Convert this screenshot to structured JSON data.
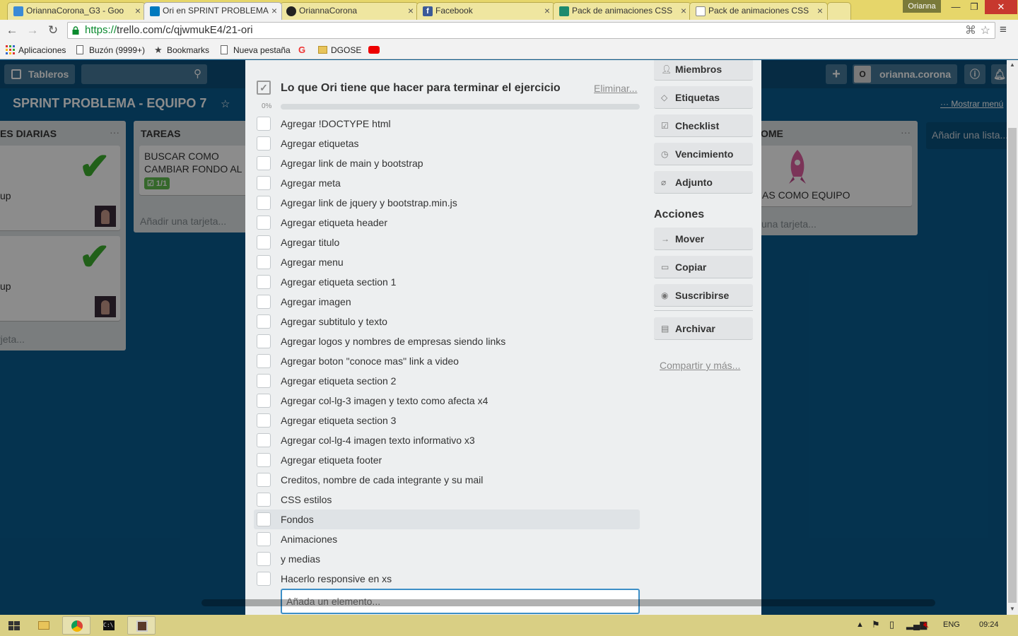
{
  "browser": {
    "tabs": [
      {
        "title": "OriannaCorona_G3 - Goo",
        "favicon_color": "#3b8ad6"
      },
      {
        "title": "Ori en SPRINT PROBLEMA",
        "favicon_color": "#0079bf"
      },
      {
        "title": "OriannaCorona",
        "favicon_color": "#222222"
      },
      {
        "title": "Facebook",
        "favicon_color": "#3b5998"
      },
      {
        "title": "Pack de animaciones CSS",
        "favicon_color": "#1e8a6e"
      },
      {
        "title": "Pack de animaciones CSS",
        "favicon_color": "#ffffff"
      }
    ],
    "user": "Orianna",
    "url_scheme": "https://",
    "url_rest": "trello.com/c/qjwmukE4/21-ori",
    "bookmarks": [
      {
        "label": "Aplicaciones",
        "icon": "apps-grid-icon"
      },
      {
        "label": "Buzón (9999+)",
        "icon": "page-icon"
      },
      {
        "label": "Bookmarks",
        "icon": "star-icon"
      },
      {
        "label": "Nueva pestaña",
        "icon": "page-icon"
      },
      {
        "label": "",
        "icon": "google-icon"
      },
      {
        "label": "DGOSE",
        "icon": "folder-icon"
      },
      {
        "label": "",
        "icon": "youtube-icon"
      }
    ]
  },
  "board": {
    "boards_button": "Tableros",
    "title": "SPRINT PROBLEMA - EQUIPO 7",
    "user_initial": "O",
    "username": "orianna.corona",
    "show_menu": "Mostrar menú",
    "lists": [
      {
        "title": "ES DIARIAS",
        "card1_text": "up",
        "card2_text": "up",
        "add": "rjeta..."
      },
      {
        "title": "TAREAS",
        "card1_text": "BUSCAR COMO CAMBIAR FONDO AL NAV",
        "badge": "1/1",
        "add": "Añadir una tarjeta..."
      },
      {
        "title": "OME",
        "card1_text": "AS COMO EQUIPO",
        "add": "una tarjeta..."
      }
    ],
    "add_list": "Añadir una lista..."
  },
  "checklist": {
    "title": "Lo que Ori tiene que hacer para terminar el ejercicio",
    "delete": "Eliminar...",
    "progress_label": "0%",
    "progress": 0,
    "items": [
      "Agregar !DOCTYPE html",
      "Agregar etiquetas",
      "Agregar link de main y bootstrap",
      "Agregar meta",
      "Agregar link de jquery y bootstrap.min.js",
      "Agregar etiqueta header",
      "Agregar titulo",
      "Agregar menu",
      "Agregar etiqueta section 1",
      "Agregar imagen",
      "Agregar subtitulo y texto",
      "Agregar logos y nombres de empresas siendo links",
      "Agregar boton \"conoce mas\" link a video",
      "Agregar etiqueta section 2",
      "Agregar col-lg-3 imagen y texto como afecta x4",
      "Agregar etiqueta section 3",
      "Agregar col-lg-4 imagen texto informativo x3",
      "Agregar etiqueta footer",
      "Creditos, nombre de cada integrante y su mail",
      "CSS estilos",
      "Fondos",
      "Animaciones",
      "y medias",
      "Hacerlo responsive en xs"
    ],
    "add_placeholder": "Añada un elemento..."
  },
  "sidebar": {
    "add_buttons": [
      {
        "label": "Miembros",
        "icon": "person-icon"
      },
      {
        "label": "Etiquetas",
        "icon": "tag-icon"
      },
      {
        "label": "Checklist",
        "icon": "checkbox-icon"
      },
      {
        "label": "Vencimiento",
        "icon": "clock-icon"
      },
      {
        "label": "Adjunto",
        "icon": "paperclip-icon"
      }
    ],
    "actions_title": "Acciones",
    "actions": [
      {
        "label": "Mover",
        "icon": "arrow-right-icon"
      },
      {
        "label": "Copiar",
        "icon": "copy-icon"
      },
      {
        "label": "Suscribirse",
        "icon": "eye-icon"
      },
      {
        "label": "Archivar",
        "icon": "archive-icon"
      }
    ],
    "share": "Compartir y más..."
  },
  "taskbar": {
    "lang": "ENG",
    "time": "09:24"
  }
}
